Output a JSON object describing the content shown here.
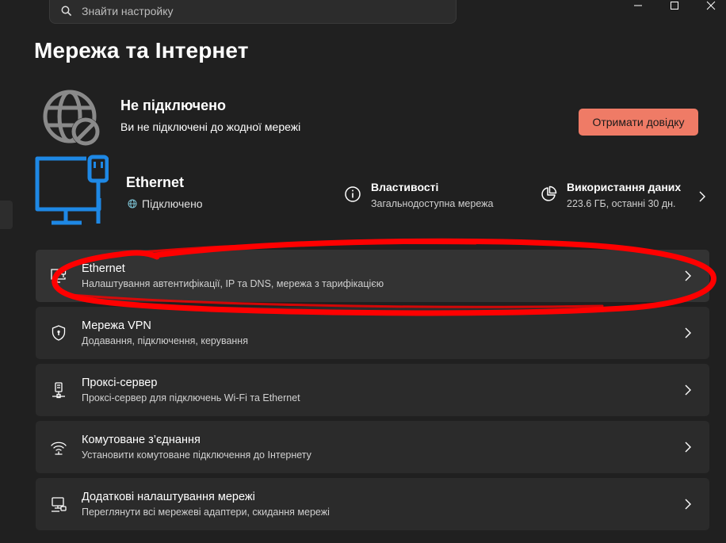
{
  "search": {
    "placeholder": "Знайти настройку"
  },
  "page": {
    "title": "Мережа та Інтернет"
  },
  "status": {
    "title": "Не підключено",
    "subtitle": "Ви не підключені до жодної мережі",
    "help_button": "Отримати довідку"
  },
  "ethernet": {
    "name": "Ethernet",
    "status": "Підключено",
    "properties": {
      "title": "Властивості",
      "subtitle": "Загальнодоступна мережа"
    },
    "usage": {
      "title": "Використання даних",
      "subtitle": "223.6 ГБ, останні 30 дн."
    }
  },
  "items": [
    {
      "title": "Ethernet",
      "subtitle": "Налаштування автентифікації, IP та DNS, мережа з тарифікацією",
      "icon": "ethernet-icon"
    },
    {
      "title": "Мережа VPN",
      "subtitle": "Додавання, підключення, керування",
      "icon": "vpn-shield-icon"
    },
    {
      "title": "Проксі-сервер",
      "subtitle": "Проксі-сервер для підключень Wi-Fi та Ethernet",
      "icon": "proxy-icon"
    },
    {
      "title": "Комутоване з’єднання",
      "subtitle": "Установити комутоване підключення до Інтернету",
      "icon": "dialup-icon"
    },
    {
      "title": "Додаткові налаштування мережі",
      "subtitle": "Переглянути всі мережеві адаптери, скидання мережі",
      "icon": "network-adapter-icon"
    }
  ],
  "colors": {
    "background": "#202020",
    "card": "#2b2b2b",
    "accent": "#ef7b66",
    "ethernet_icon": "#1e88e5",
    "annotation": "#ff0000"
  }
}
